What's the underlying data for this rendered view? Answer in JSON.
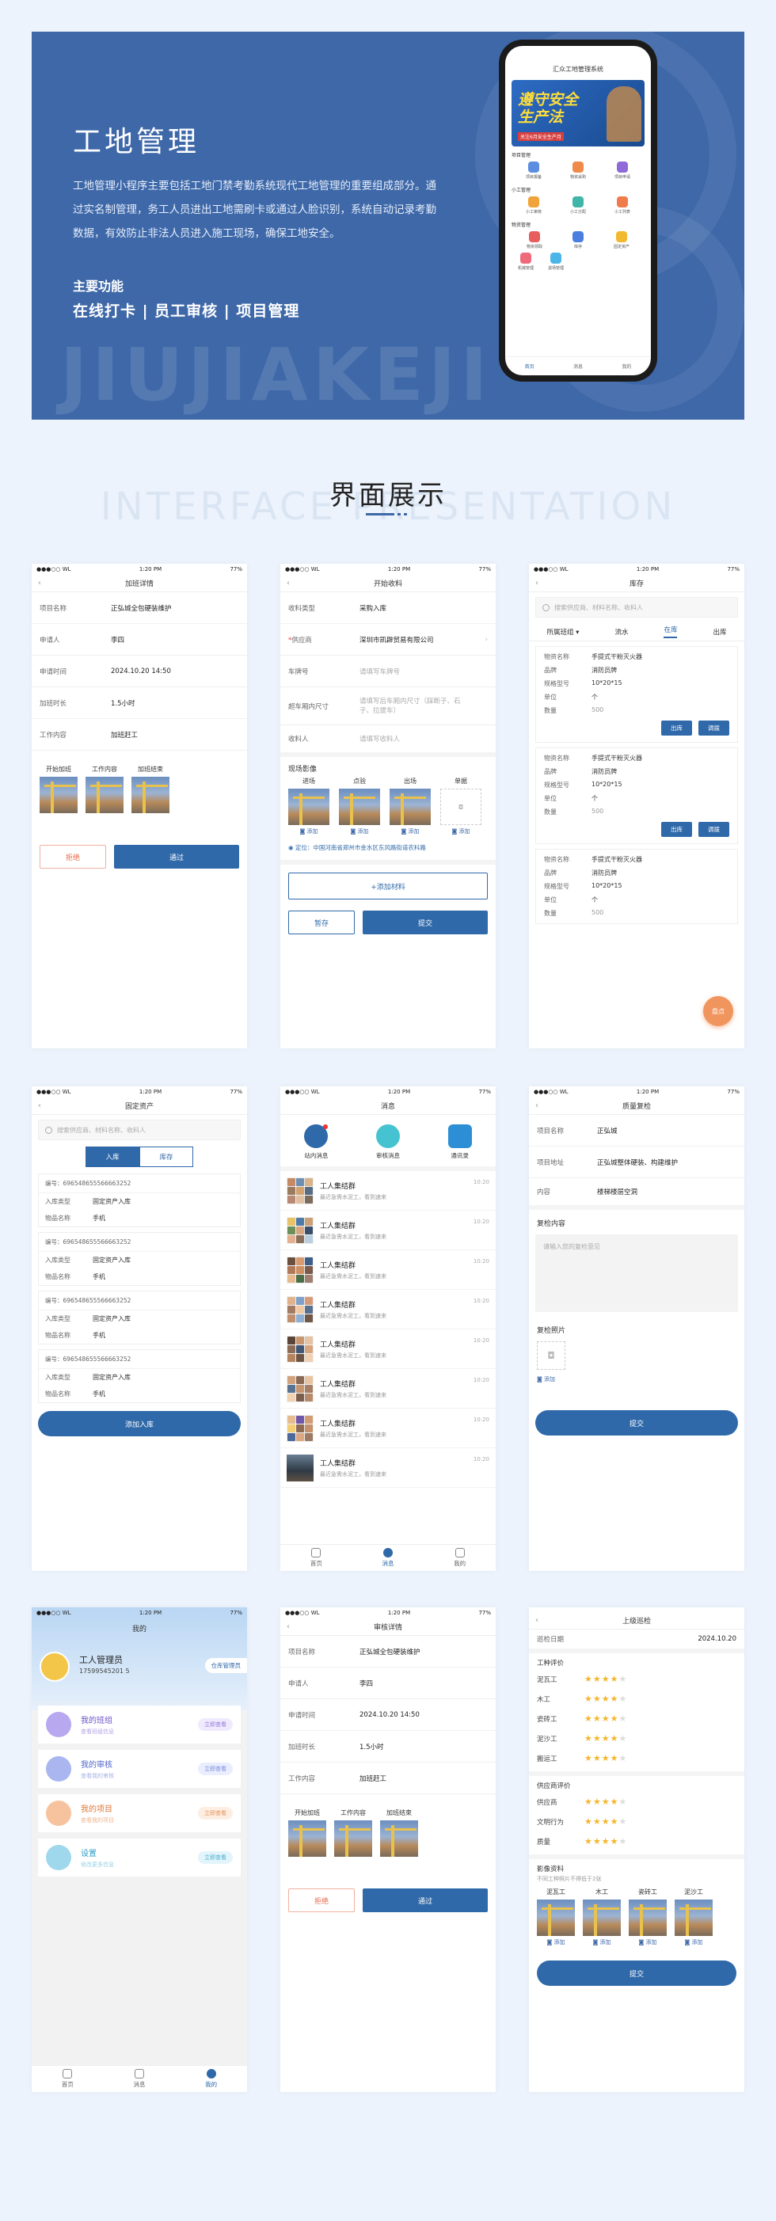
{
  "hero": {
    "title": "工地管理",
    "desc": "工地管理小程序主要包括工地门禁考勤系统现代工地管理的重要组成部分。通过实名制管理，务工人员进出工地需刷卡或通过人脸识别，系统自动记录考勤数据，有效防止非法人员进入施工现场，确保工地安全。",
    "features_heading": "主要功能",
    "features": "在线打卡 | 员工审核 | 项目管理",
    "watermark": "JIUJIAKEJI",
    "phone": {
      "title": "汇众工地管理系统",
      "banner_title_1": "遵守安全",
      "banner_title_2": "生产法",
      "banner_sub": "关注6月安全生产月",
      "sec1": "项目管理",
      "sec1_items": [
        "项目报备",
        "物资采购",
        "项目申请"
      ],
      "sec2": "小工管理",
      "sec2_items": [
        "小工审核",
        "小工分配",
        "小工列表"
      ],
      "sec3": "物资管理",
      "sec3_items": [
        "物资领取",
        "库存",
        "固定资产"
      ],
      "sec3_items2": [
        "机械管理",
        "退场管理"
      ],
      "tabs": [
        "首页",
        "消息",
        "我的"
      ]
    }
  },
  "section": {
    "title": "界面展示",
    "watermark": "INTERFACE PRESENTATION"
  },
  "status": {
    "carrier": "●●●○○ WL",
    "time": "1:20 PM",
    "battery": "77%"
  },
  "s1": {
    "title": "加班详情",
    "rows": [
      {
        "k": "项目名称",
        "v": "正弘城全包硬装维护"
      },
      {
        "k": "申请人",
        "v": "李四"
      },
      {
        "k": "申请时间",
        "v": "2024.10.20   14:50"
      },
      {
        "k": "加班时长",
        "v": "1.5小时"
      },
      {
        "k": "工作内容",
        "v": "加班赶工"
      }
    ],
    "photos": [
      "开始加班",
      "工作内容",
      "加班结束"
    ],
    "reject": "拒绝",
    "pass": "通过"
  },
  "s2": {
    "title": "开始收料",
    "rows": [
      {
        "k": "收料类型",
        "v": "采购入库",
        "ph": false
      },
      {
        "k": "供应商",
        "v": "深圳市凯辟贸易有限公司",
        "ph": false,
        "req": true
      },
      {
        "k": "车牌号",
        "v": "请填写车牌号",
        "ph": true
      },
      {
        "k": "超车厢内尺寸",
        "v": "请填写后车厢内尺寸（踩断子、石子、拉提车）",
        "ph": true
      },
      {
        "k": "收料人",
        "v": "请填写收料人",
        "ph": true
      }
    ],
    "scene": "现场影像",
    "photos": [
      "进场",
      "点验",
      "出场",
      "单据"
    ],
    "add": "添加",
    "location": "定位：中国河南省郑州市金水区东风路街道农科路",
    "add_material": "+添加材料",
    "save": "暂存",
    "submit": "提交"
  },
  "s3": {
    "title": "库存",
    "search": "搜索供应商、材料名称、收料人",
    "tabs": [
      "所属班组 ▾",
      "流水",
      "在库",
      "出库"
    ],
    "item": {
      "k1": "物资名称",
      "v1": "手提式干粉灭火器",
      "k2": "品牌",
      "v2": "消防员牌",
      "k3": "规格型号",
      "v3": "10*20*15",
      "k4": "单位",
      "v4": "个",
      "k5": "数量",
      "v5": "500"
    },
    "out": "出库",
    "adjust": "调拨",
    "fab": "盘点"
  },
  "s4": {
    "title": "固定资产",
    "search": "搜索供应商、材料名称、收料人",
    "seg": [
      "入库",
      "库存"
    ],
    "no": "编号：696548655566663252",
    "k1": "入库类型",
    "v1": "固定资产入库",
    "k2": "物品名称",
    "v2": "手机",
    "add": "添加入库"
  },
  "s5": {
    "title": "消息",
    "top": [
      "站内消息",
      "审核消息",
      "通讯录"
    ],
    "item": {
      "name": "工人集结群",
      "desc": "最近急需水泥工，看到速来",
      "time": "10:20"
    },
    "tabs": [
      "首页",
      "消息",
      "我的"
    ]
  },
  "s6": {
    "title": "质量复检",
    "rows": [
      {
        "k": "项目名称",
        "v": "正弘城"
      },
      {
        "k": "项目地址",
        "v": "正弘城整体硬装、构建维护"
      },
      {
        "k": "内容",
        "v": "楼梯楼层空洞"
      }
    ],
    "content_label": "复检内容",
    "content_ph": "请输入您的复检意见",
    "photo_label": "复检照片",
    "add": "添加",
    "submit": "提交"
  },
  "s7": {
    "title": "我的",
    "name": "工人管理员",
    "phone": "17599545201 5",
    "role_btn": "仓库管理员",
    "items": [
      {
        "t": "我的班组",
        "s": "查看班组信息",
        "tag": "立即查看"
      },
      {
        "t": "我的审核",
        "s": "查看我的审核",
        "tag": "立即查看"
      },
      {
        "t": "我的项目",
        "s": "查看我的项目",
        "tag": "立即查看"
      },
      {
        "t": "设置",
        "s": "修改更多信息",
        "tag": "立即查看"
      }
    ],
    "tabs": [
      "首页",
      "消息",
      "我的"
    ]
  },
  "s8": {
    "title": "审核详情",
    "rows": [
      {
        "k": "项目名称",
        "v": "正弘城全包硬装维护"
      },
      {
        "k": "申请人",
        "v": "李四"
      },
      {
        "k": "申请时间",
        "v": "2024.10.20   14:50"
      },
      {
        "k": "加班时长",
        "v": "1.5小时"
      },
      {
        "k": "工作内容",
        "v": "加班赶工"
      }
    ],
    "photos": [
      "开始加班",
      "工作内容",
      "加班结束"
    ],
    "reject": "拒绝",
    "pass": "通过"
  },
  "s9": {
    "title": "上级巡检",
    "date_k": "巡检日期",
    "date_v": "2024.10.20",
    "worker_h": "工种评价",
    "workers": [
      {
        "k": "泥瓦工",
        "stars": 4
      },
      {
        "k": "木工",
        "stars": 4
      },
      {
        "k": "瓷砖工",
        "stars": 4
      },
      {
        "k": "泥沙工",
        "stars": 4
      },
      {
        "k": "搬运工",
        "stars": 4
      }
    ],
    "supplier_h": "供应商评价",
    "supplier": {
      "k": "供应商",
      "stars": 4
    },
    "others": [
      {
        "k": "文明行为",
        "stars": 4
      },
      {
        "k": "质量",
        "stars": 4
      }
    ],
    "image_h": "影像资料",
    "image_sub": "不同工种照片不得低于2张",
    "image_labels": [
      "泥瓦工",
      "木工",
      "瓷砖工",
      "泥沙工"
    ],
    "add": "添加",
    "submit": "提交"
  },
  "colors": {
    "primary": "#2f69a9",
    "hero": "#3e68a8",
    "orange": "#f0955e"
  }
}
